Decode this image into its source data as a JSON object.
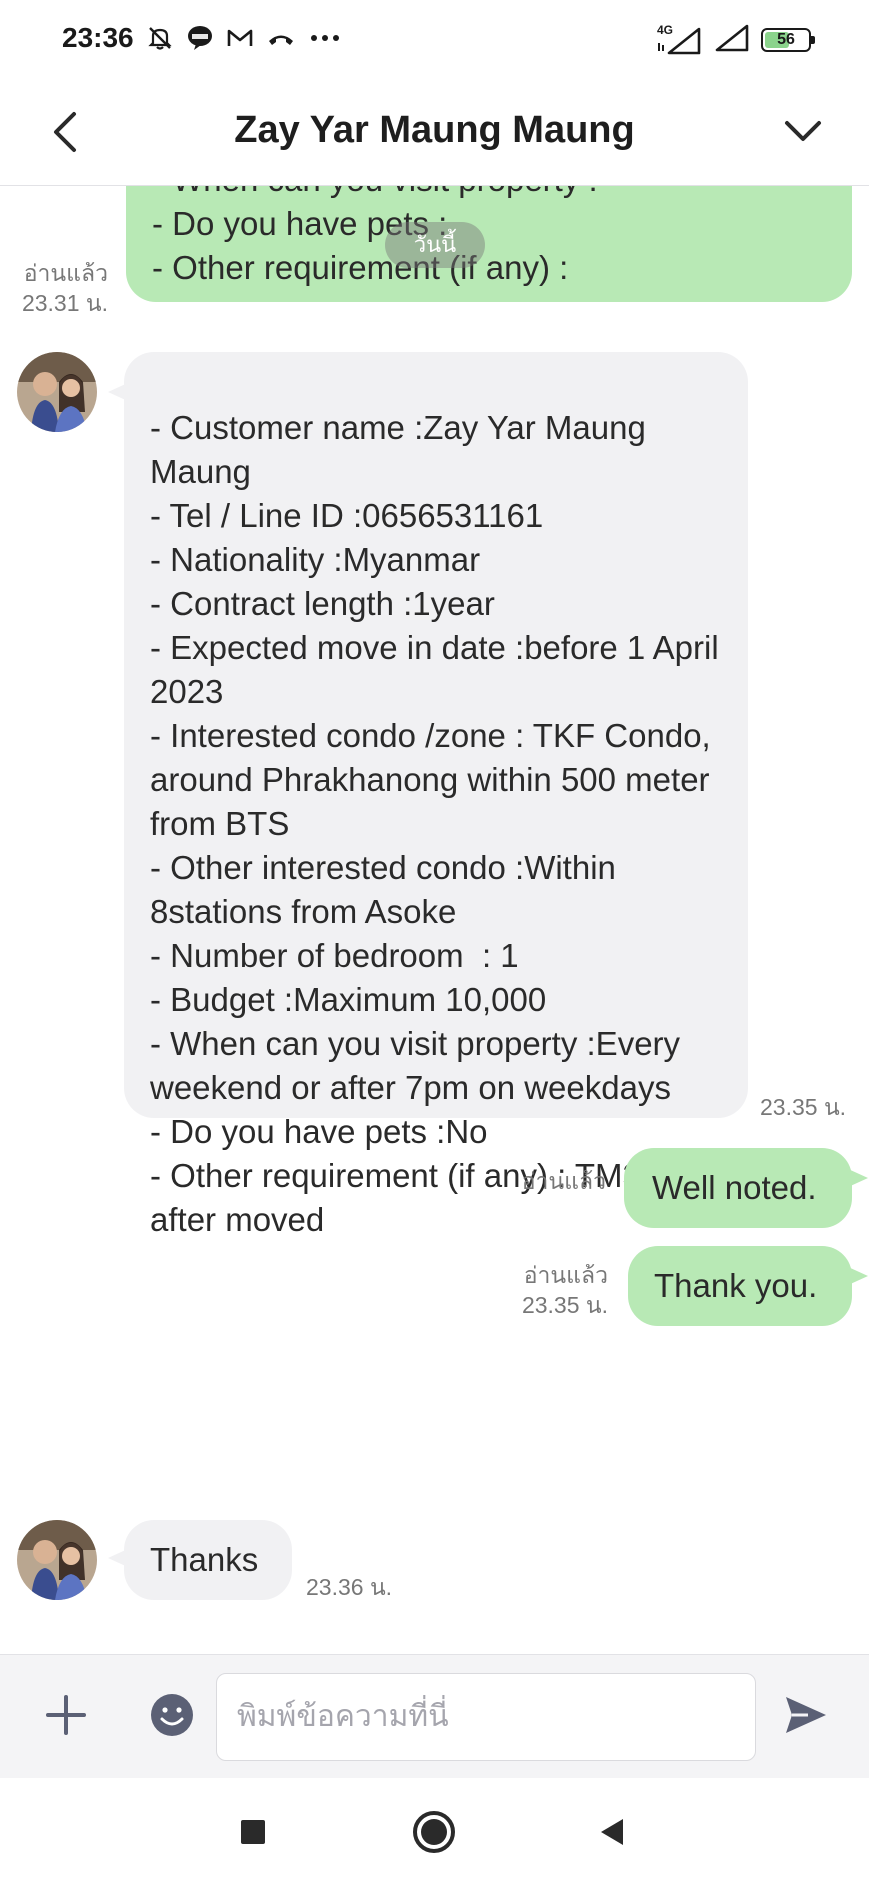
{
  "status_bar": {
    "time": "23:36",
    "network": "4G",
    "battery": "56",
    "battery_level_percent": 56,
    "icons_left": [
      "bell-off-icon",
      "line-icon",
      "gmail-icon",
      "missed-call-icon",
      "more-dots-icon"
    ],
    "icons_right": [
      "signal-4g-icon",
      "signal-icon",
      "battery-icon"
    ]
  },
  "header": {
    "title": "Zay Yar Maung Maung",
    "back_icon": "chevron-left-icon",
    "menu_icon": "chevron-down-icon"
  },
  "date_pill": "วันนี้",
  "messages": [
    {
      "direction": "out",
      "text": "- When can you visit property :\n- Do you have pets :\n- Other requirement (if any) :",
      "read": "อ่านแล้ว",
      "time": "23.31 น."
    },
    {
      "direction": "in",
      "text": "\n- Customer name :Zay Yar Maung Maung\n- Tel / Line ID :0656531161\n- Nationality :Myanmar\n- Contract length :1year\n- Expected move in date :before 1 April 2023\n- Interested condo /zone : TKF Condo, around Phrakhanong within 500 meter from BTS\n- Other interested condo :Within 8stations from Asoke\n- Number of bedroom  : 1\n- Budget :Maximum 10,000\n- When can you visit property :Every weekend or after 7pm on weekdays\n- Do you have pets :No\n- Other requirement (if any) : TM30 after moved",
      "time": "23.35 น."
    },
    {
      "direction": "out",
      "text": "Well noted.",
      "read": "อ่านแล้ว"
    },
    {
      "direction": "out",
      "text": "Thank you.",
      "read": "อ่านแล้ว",
      "time": "23.35 น."
    },
    {
      "direction": "in",
      "text": "Thanks",
      "time": "23.36 น."
    }
  ],
  "input_bar": {
    "placeholder": "พิมพ์ข้อความที่นี่",
    "value": "",
    "add_icon": "plus-icon",
    "emoji_icon": "smiley-icon",
    "send_icon": "send-icon"
  },
  "nav_bar": {
    "icons": [
      "recents-square-icon",
      "home-circle-icon",
      "back-triangle-icon"
    ]
  },
  "colors": {
    "outgoing_bubble": "#b8e9b5",
    "incoming_bubble": "#f1f1f3",
    "icon_gray": "#5b6075",
    "battery_fill": "#8bd38c"
  }
}
